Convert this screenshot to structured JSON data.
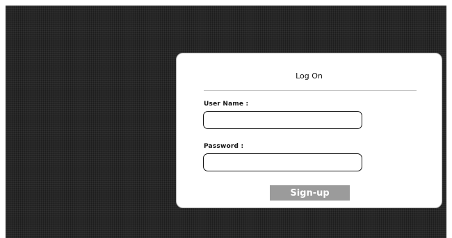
{
  "login": {
    "title": "Log On",
    "username": {
      "label": "User Name :",
      "value": ""
    },
    "password": {
      "label": "Password :",
      "value": ""
    },
    "signup_label": "Sign-up"
  }
}
